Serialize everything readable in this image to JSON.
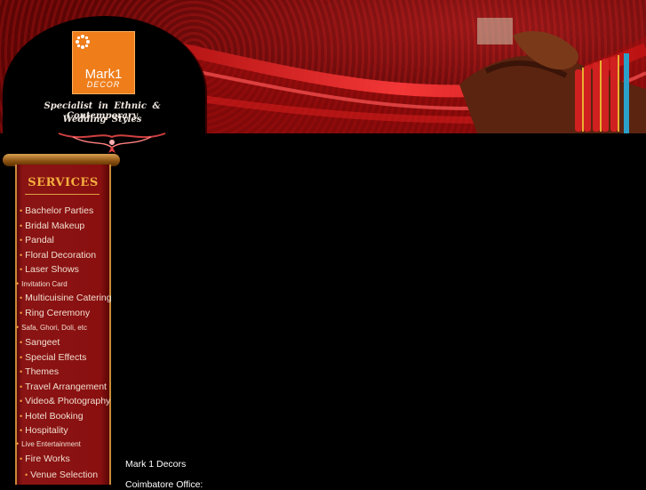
{
  "brand": {
    "logo_main": "Mark1",
    "logo_sub": "DECOR",
    "tagline_line1": "Specialist in Ethnic & Contemporary",
    "tagline_line2": "Wedding Styles"
  },
  "services": {
    "title": "SERVICES",
    "items": [
      {
        "label": "Bachelor Parties",
        "style": "big"
      },
      {
        "label": "Bridal Makeup",
        "style": "big"
      },
      {
        "label": "Pandal",
        "style": "big"
      },
      {
        "label": "Floral Decoration",
        "style": "big"
      },
      {
        "label": "Laser Shows",
        "style": "big"
      },
      {
        "label": "Invitation Card",
        "style": "small"
      },
      {
        "label": "Multicuisine Catering",
        "style": "big"
      },
      {
        "label": "Ring Ceremony",
        "style": "big"
      },
      {
        "label": "Safa, Ghori, Doli, etc",
        "style": "small"
      },
      {
        "label": "Sangeet",
        "style": "big"
      },
      {
        "label": "Special Effects",
        "style": "big"
      },
      {
        "label": "Themes",
        "style": "big"
      },
      {
        "label": "Travel Arrangement",
        "style": "big"
      },
      {
        "label": "Video& Photography",
        "style": "big"
      },
      {
        "label": "Hotel Booking",
        "style": "big"
      },
      {
        "label": "Hospitality",
        "style": "big"
      },
      {
        "label": "Live Entertainment",
        "style": "small"
      },
      {
        "label": "Fire Works",
        "style": "big"
      },
      {
        "label": "Venue Selection",
        "style": "indent"
      }
    ]
  },
  "content": {
    "company_name": "Mark 1 Decors",
    "office_label": "Coimbatore Office:"
  },
  "colors": {
    "banner_red": "#8a0c0c",
    "logo_orange": "#ee7d1a",
    "panel_red": "#8a1414",
    "title_gold": "#f4b040"
  }
}
